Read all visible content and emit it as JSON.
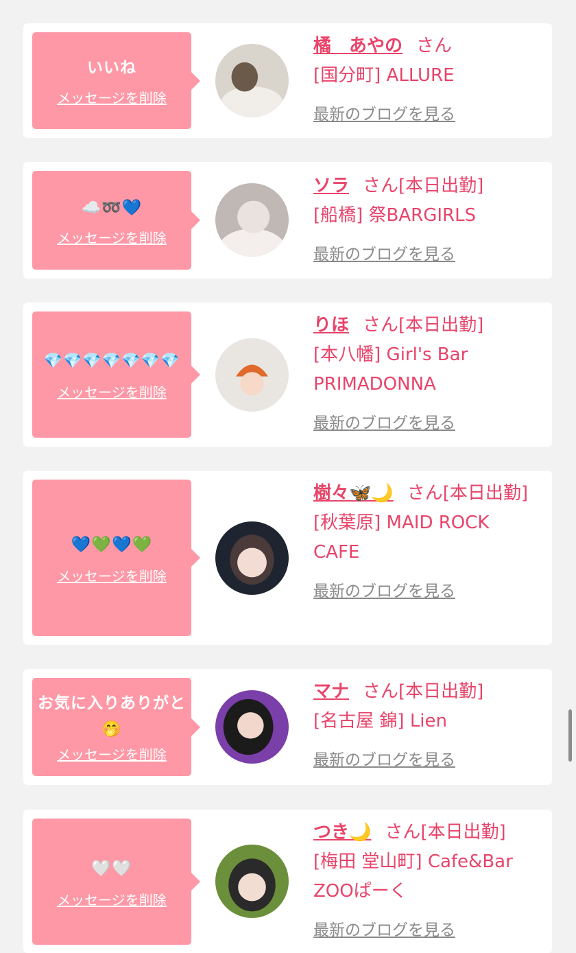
{
  "common": {
    "delete_label": "メッセージを削除",
    "blog_label": "最新のブログを見る"
  },
  "cards": [
    {
      "message": "いいね",
      "name": "橘　あやの",
      "suffix": "さん",
      "shop": "[国分町] ALLURE",
      "avatar_colors": [
        "#d9d4cc",
        "#6b5a4a",
        "#f1eeea"
      ]
    },
    {
      "message": "☁️➿💙",
      "name": "ソラ",
      "suffix": "さん[本日出勤]",
      "shop": "[船橋] 祭BARGIRLS",
      "avatar_colors": [
        "#bfb8b4",
        "#e9e2de",
        "#f4efec"
      ]
    },
    {
      "message": "💎💎💎💎💎💎💎",
      "name": "りほ",
      "suffix": "さん[本日出勤]",
      "shop": "[本八幡] Girl's Bar PRIMADONNA",
      "avatar_colors": [
        "#e9e6e2",
        "#e06a2c",
        "#f6d9c8"
      ]
    },
    {
      "message": "💙💚💙💚",
      "name": "樹々🦋🌙",
      "suffix": "さん[本日出勤]",
      "shop": "[秋葉原] MAID ROCK CAFE",
      "avatar_colors": [
        "#1f2530",
        "#4a3a3a",
        "#f3dcd4"
      ]
    },
    {
      "message": "お気に入りありがと🤭",
      "name": "マナ",
      "suffix": "さん[本日出勤]",
      "shop": "[名古屋 錦] Lien",
      "avatar_colors": [
        "#7a3fa8",
        "#1b1b1b",
        "#f1d7cc"
      ]
    },
    {
      "message": "🤍🤍",
      "name": "つき🌙",
      "suffix": "さん[本日出勤]",
      "shop": "[梅田 堂山町] Cafe&Bar ZOOぱーく",
      "avatar_colors": [
        "#6b8f3a",
        "#2a2a2a",
        "#f2ddd3"
      ]
    }
  ]
}
